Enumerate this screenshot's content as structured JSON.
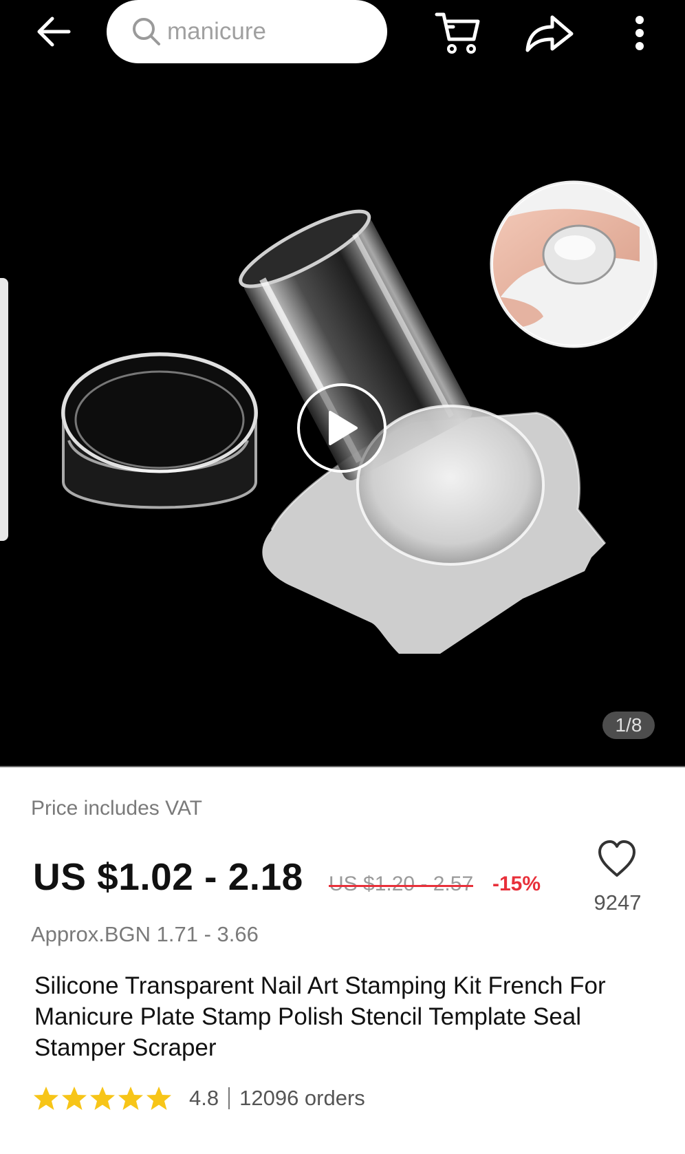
{
  "search": {
    "placeholder": "manicure"
  },
  "topbar": {
    "back_icon": "arrow-left-icon",
    "cart_icon": "cart-icon",
    "share_icon": "share-icon",
    "more_icon": "more-vertical-icon"
  },
  "gallery": {
    "counter": "1/8"
  },
  "product": {
    "vat_note": "Price includes VAT",
    "price": "US $1.02 - 2.18",
    "old_price": "US $1.20 - 2.57",
    "discount": "-15%",
    "approx_price": "Approx.BGN 1.71 - 3.66",
    "title": "Silicone Transparent Nail Art Stamping Kit French For Manicure Plate Stamp Polish Stencil Template Seal Stamper Scraper",
    "wishlist_count": "9247",
    "rating": "4.8",
    "rating_stars": 5,
    "orders": "12096 orders"
  },
  "colors": {
    "accent_red": "#e8303a",
    "star_yellow": "#f7c518",
    "background_dark": "#000000"
  }
}
